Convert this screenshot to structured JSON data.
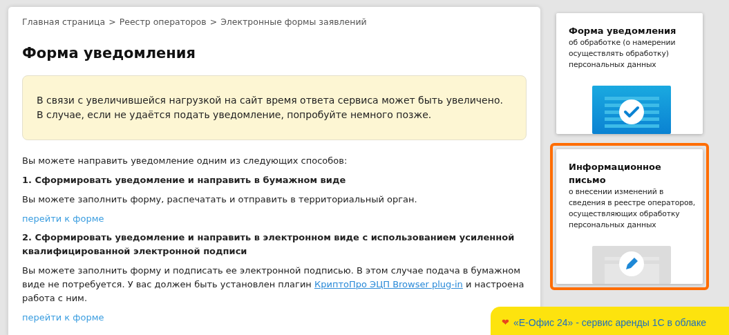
{
  "breadcrumbs": [
    "Главная страница",
    "Реестр операторов",
    "Электронные формы заявлений"
  ],
  "breadcrumb_separator": ">",
  "title": "Форма уведомления",
  "notice": [
    "В связи с увеличившейся нагрузкой на сайт время ответа сервиса может быть увеличено.",
    "В случае, если не удаётся подать уведомление, попробуйте немного позже."
  ],
  "intro": "Вы можете направить уведомление одним из следующих способов:",
  "methods": [
    {
      "heading": "1. Сформировать уведомление и направить в бумажном виде",
      "text_before": "Вы можете заполнить форму, распечатать и отправить в территориальный орган.",
      "link": "перейти к форме"
    },
    {
      "heading": "2. Сформировать уведомление и направить в электронном виде с использованием усиленной квалифицированной электронной подписи",
      "text_before": "Вы можете заполнить форму и подписать ее электронной подписью. В этом случае подача в бумажном виде не потребуется. У вас должен быть установлен плагин ",
      "inline_link": "КриптоПро ЭЦП Browser plug-in",
      "text_after": " и настроена работа с ним.",
      "link": "перейти к форме"
    }
  ],
  "cards": [
    {
      "title": "Форма уведомления",
      "text": "об обработке (о намерении осуществлять обработку) персональных данных",
      "kind": "check",
      "selected": false
    },
    {
      "title": "Информационное письмо",
      "text": "о внесении изменений в сведения в реестре операторов, осуществляющих обработку персональных данных",
      "kind": "pencil",
      "selected": true
    }
  ],
  "promo": {
    "icon": "❤",
    "text": "«Е-Офис 24» - сервис аренды 1С в облаке"
  }
}
